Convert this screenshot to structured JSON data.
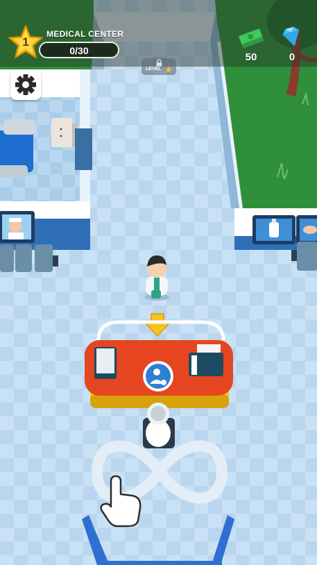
{
  "hud": {
    "level": "1",
    "location_title": "MEDICAL CENTER",
    "progress_text": "0/30",
    "progress_fraction": 0,
    "cash_value": "50",
    "gems_value": "0"
  },
  "locked_area": {
    "label": "LEVEL"
  },
  "icons": {
    "settings": "gear-icon",
    "cash": "cash-stack-icon",
    "gems": "diamond-icon",
    "lock": "lock-icon",
    "desk_action": "patient-queue-icon",
    "hand": "pointing-hand-icon",
    "arrow": "arrow-down-icon"
  },
  "colors": {
    "floor": "#bcd8ef",
    "grass": "#2f8f3a",
    "desk": "#e5451f",
    "desk_trim": "#f5c418",
    "star": "#f7c21c",
    "progress_fill": "#59c24a",
    "cash": "#43c85a",
    "gem": "#4fc3f7"
  }
}
